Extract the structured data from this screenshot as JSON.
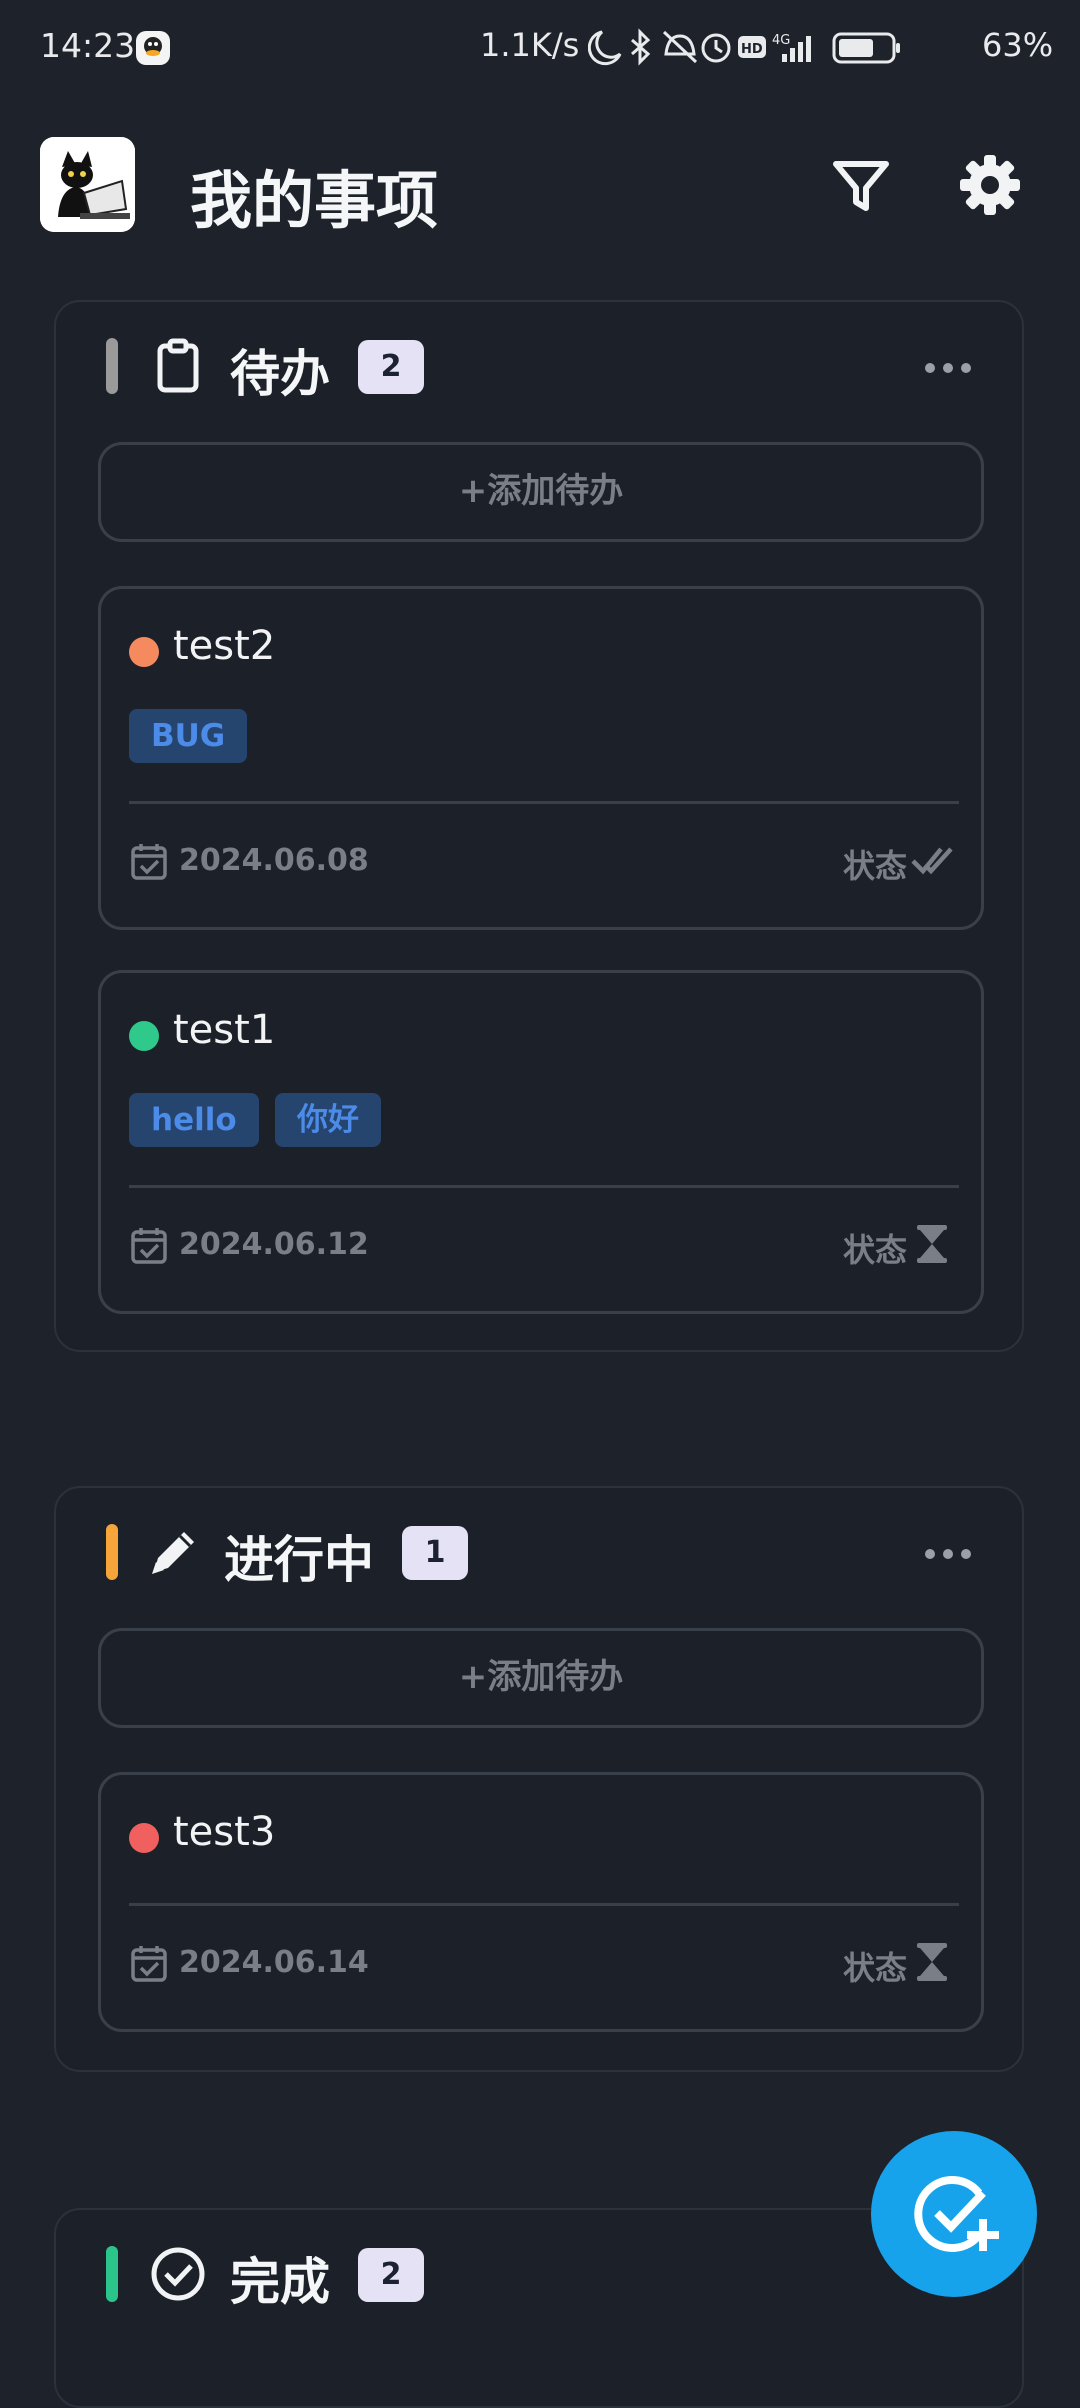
{
  "status_bar": {
    "time": "14:23",
    "net_speed": "1.1K/s",
    "network": "4G",
    "battery": "63%",
    "icons": [
      "qq-icon",
      "moon-icon",
      "bluetooth-icon",
      "mute-icon",
      "alarm-icon",
      "hd-icon",
      "signal-icon",
      "battery-icon"
    ]
  },
  "header": {
    "title": "我的事项",
    "filter_icon": "filter-icon",
    "settings_icon": "gear-icon"
  },
  "colors": {
    "background": "#1d222b",
    "todo_bar": "#9a9a9a",
    "inprogress_bar": "#f5a53a",
    "done_bar": "#2bc48a",
    "dot_orange": "#f58a5f",
    "dot_green": "#2fc98b",
    "dot_red": "#f0605f",
    "tag_text": "#4c8be8",
    "fab": "#16a3ec"
  },
  "sections": [
    {
      "title": "待办",
      "count": "2",
      "icon": "clipboard-icon",
      "add_label": "添加待办",
      "cards": [
        {
          "title": "test2",
          "dot": "orange",
          "tags": [
            "BUG"
          ],
          "date": "2024.06.08",
          "status_label": "状态",
          "status_icon": "double-check-icon"
        },
        {
          "title": "test1",
          "dot": "green",
          "tags": [
            "hello",
            "你好"
          ],
          "date": "2024.06.12",
          "status_label": "状态",
          "status_icon": "hourglass-icon"
        }
      ]
    },
    {
      "title": "进行中",
      "count": "1",
      "icon": "pencil-icon",
      "add_label": "添加待办",
      "cards": [
        {
          "title": "test3",
          "dot": "red",
          "tags": [],
          "date": "2024.06.14",
          "status_label": "状态",
          "status_icon": "hourglass-icon"
        }
      ]
    },
    {
      "title": "完成",
      "count": "2",
      "icon": "check-circle-icon"
    }
  ],
  "fab_icon": "add-task-icon"
}
